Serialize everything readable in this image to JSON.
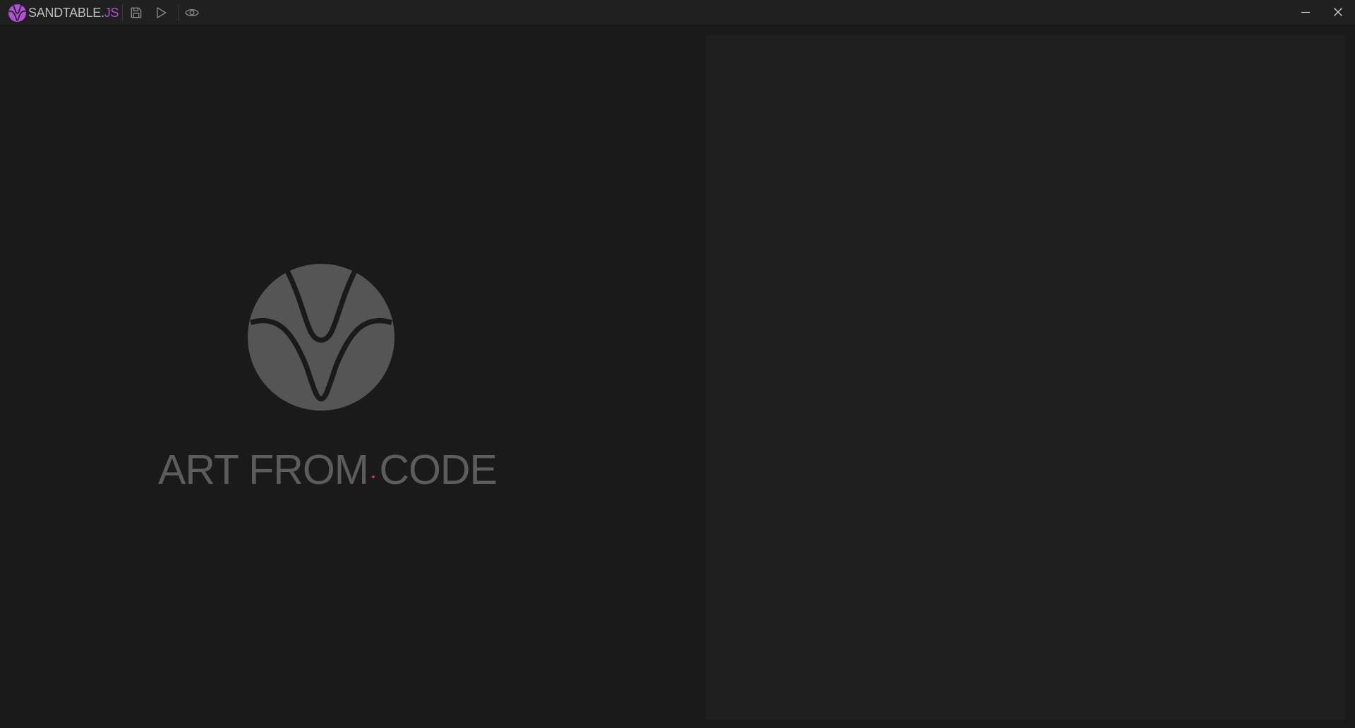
{
  "app": {
    "brand_name": "SANDTABLE",
    "brand_dot": ".",
    "brand_ext": "JS"
  },
  "toolbar": {
    "save_icon": "save-icon",
    "run_icon": "play-icon",
    "preview_icon": "eye-icon"
  },
  "window_controls": {
    "minimize_icon": "minimize-icon",
    "close_icon": "close-icon"
  },
  "splash": {
    "tagline": "ART FROM CODE",
    "logo_icon": "sandtable-logo"
  },
  "colors": {
    "background": "#1a1a1a",
    "titlebar": "#202020",
    "preview_panel": "#1f1f1f",
    "brand_accent": "#a855cf",
    "logo_grey": "#555555",
    "text_grey": "#5c5c5c"
  }
}
